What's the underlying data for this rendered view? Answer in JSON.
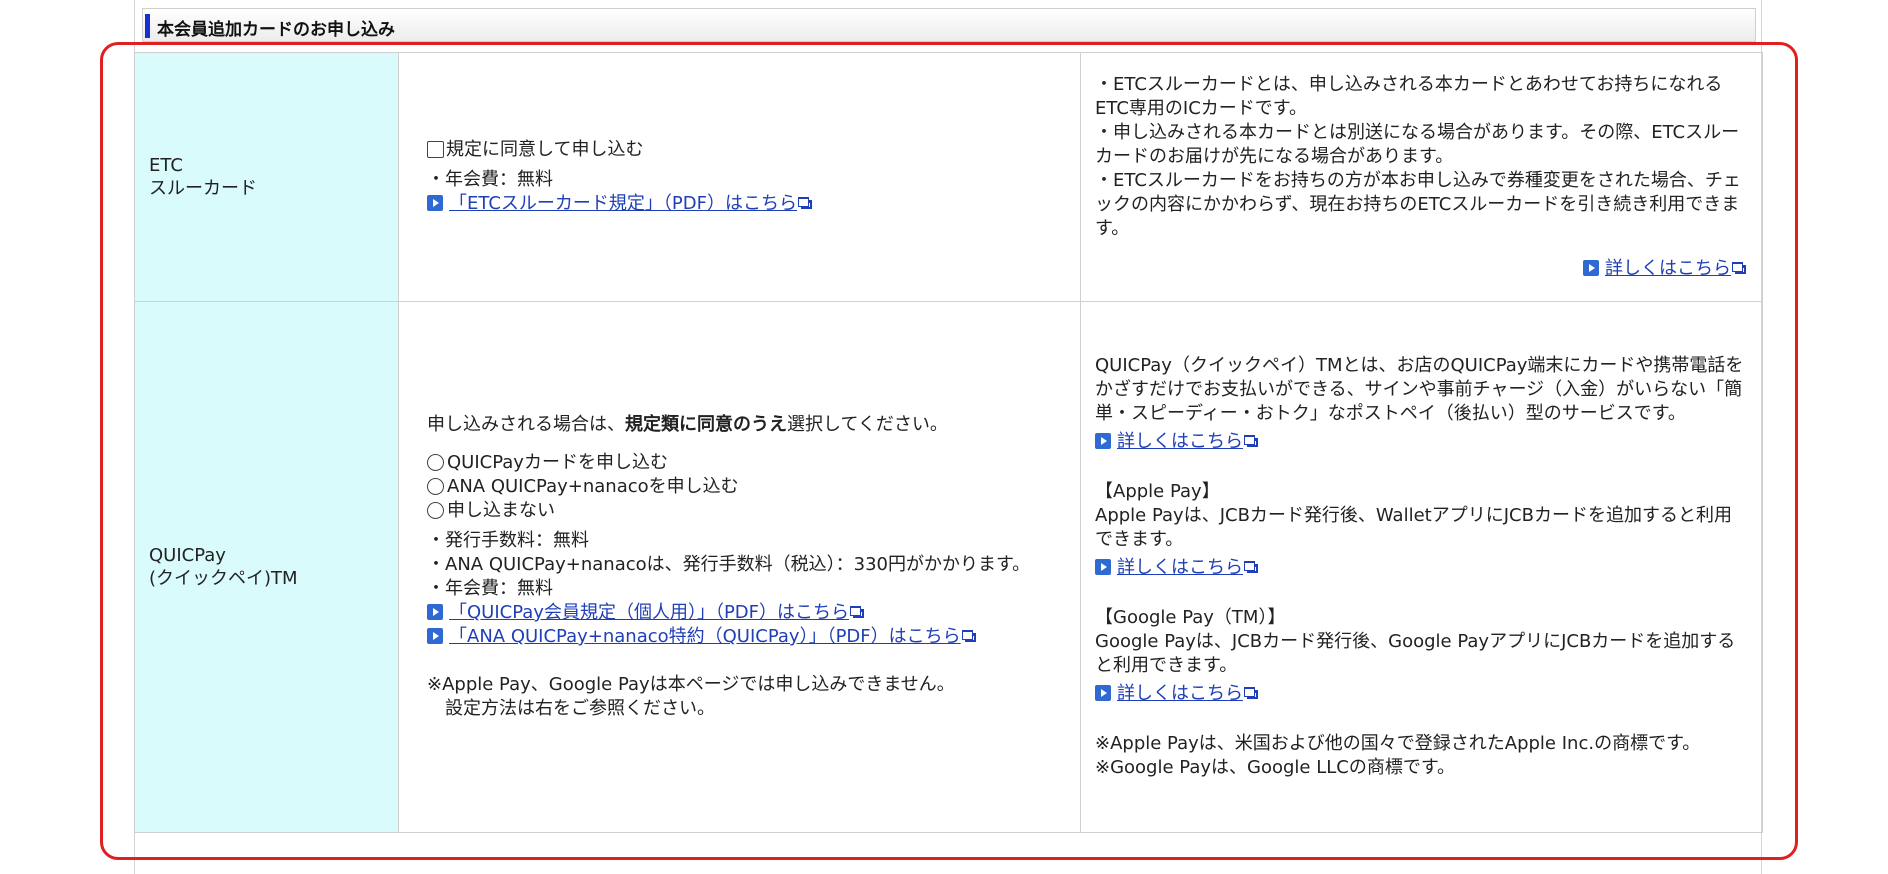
{
  "section": {
    "title": "本会員追加カードのお申し込み"
  },
  "etc": {
    "label_line1": "ETC",
    "label_line2": "スルーカード",
    "checkbox_label": "規定に同意して申し込む",
    "fee": "・年会費：無料",
    "terms_link": "「ETCスルーカード規定」（PDF）はこちら",
    "desc": [
      "・ETCスルーカードとは、申し込みされる本カードとあわせてお持ちになれるETC専用のICカードです。",
      "・申し込みされる本カードとは別送になる場合があります。その際、ETCスルーカードのお届けが先になる場合があります。",
      "・ETCスルーカードをお持ちの方が本お申し込みで券種変更をされた場合、チェックの内容にかかわらず、現在お持ちのETCスルーカードを引き続き利用できます。"
    ],
    "detail_link": "詳しくはこちら"
  },
  "quicpay": {
    "label_line1": "QUICPay",
    "label_line2": "(クイックペイ)TM",
    "instruction_pre": "申し込みされる場合は、",
    "instruction_bold": "規定類に同意のうえ",
    "instruction_post": "選択してください。",
    "options": [
      "QUICPayカードを申し込む",
      "ANA QUICPay+nanacoを申し込む",
      "申し込まない"
    ],
    "fees": [
      "・発行手数料：無料",
      "・ANA QUICPay+nanacoは、発行手数料（税込）：330円がかかります。",
      "・年会費：無料"
    ],
    "links": [
      "「QUICPay会員規定（個人用）」（PDF）はこちら",
      "「ANA QUICPay+nanaco特約（QUICPay）」（PDF）はこちら"
    ],
    "note_line1": "※Apple Pay、Google Payは本ページでは申し込みできません。",
    "note_line2": "設定方法は右をご参照ください。",
    "right": {
      "intro": "QUICPay（クイックペイ）TMとは、お店のQUICPay端末にカードや携帯電話をかざすだけでお支払いができる、サインや事前チャージ（入金）がいらない「簡単・スピーディー・おトク」なポストペイ（後払い）型のサービスです。",
      "detail_link": "詳しくはこちら",
      "apple_heading": "【Apple Pay】",
      "apple_text": "Apple Payは、JCBカード発行後、WalletアプリにJCBカードを追加すると利用できます。",
      "apple_link": "詳しくはこちら",
      "google_heading": "【Google Pay（TM）】",
      "google_text": "Google Payは、JCBカード発行後、Google PayアプリにJCBカードを追加すると利用できます。",
      "google_link": "詳しくはこちら",
      "trademark1": "※Apple Payは、米国および他の国々で登録されたApple Inc.の商標です。",
      "trademark2": "※Google Payは、Google LLCの商標です。"
    }
  },
  "colors": {
    "label_bg": "#d9fbfb",
    "link": "#1f3fb8",
    "highlight": "#e02020",
    "header_bar": "#1a2fd1"
  }
}
